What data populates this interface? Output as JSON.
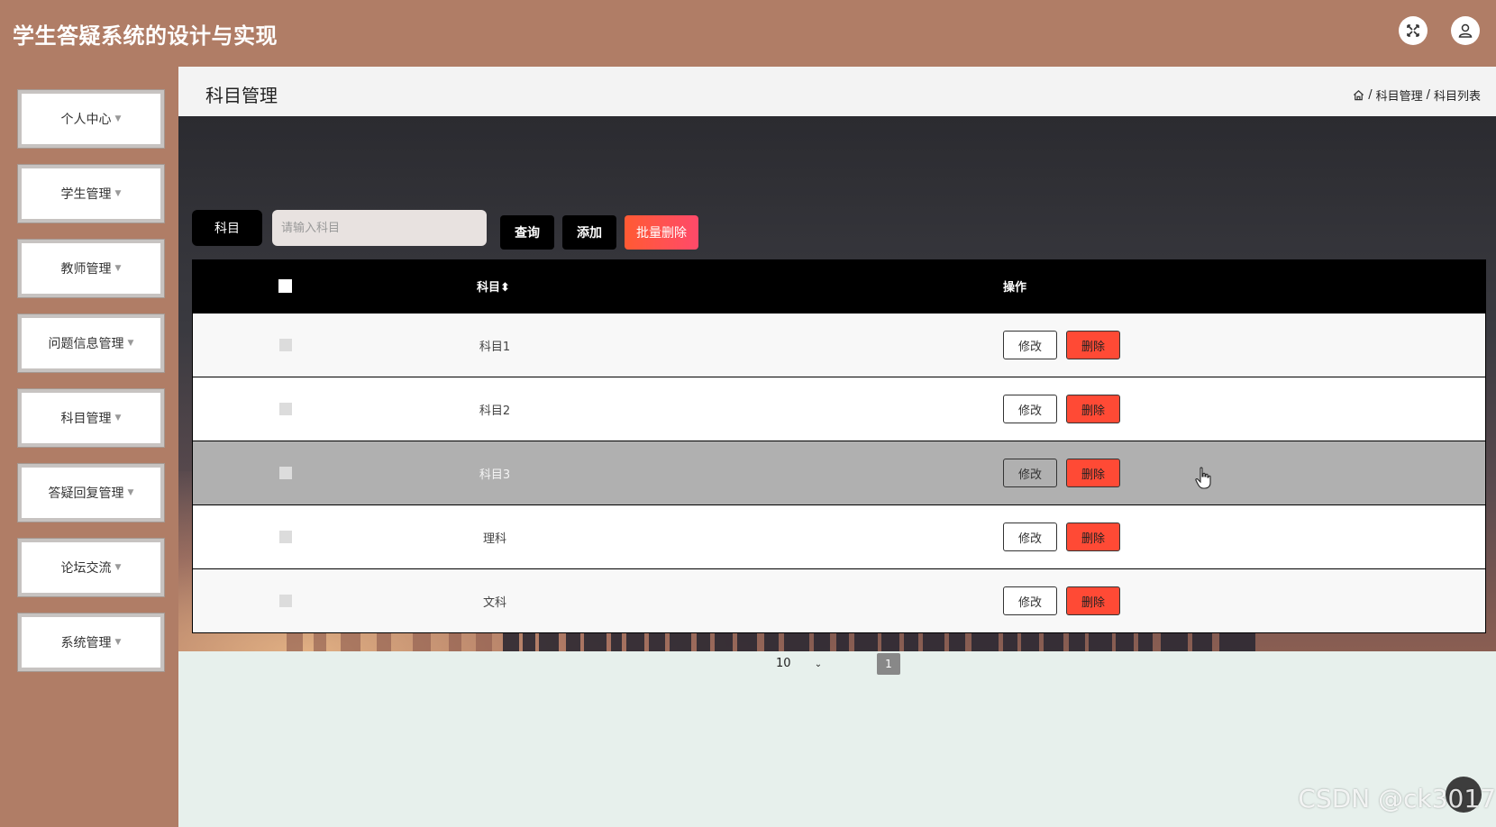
{
  "app": {
    "title": "学生答疑系统的设计与实现"
  },
  "header": {
    "fullscreen_icon": "fullscreen-icon",
    "user_icon": "user-icon"
  },
  "sidebar": {
    "items": [
      {
        "label": "个人中心"
      },
      {
        "label": "学生管理"
      },
      {
        "label": "教师管理"
      },
      {
        "label": "问题信息管理"
      },
      {
        "label": "科目管理"
      },
      {
        "label": "答疑回复管理"
      },
      {
        "label": "论坛交流"
      },
      {
        "label": "系统管理"
      }
    ]
  },
  "page": {
    "title": "科目管理",
    "breadcrumb": [
      "科目管理",
      "科目列表"
    ]
  },
  "search": {
    "label": "科目",
    "placeholder": "请输入科目",
    "query_label": "查询",
    "add_label": "添加",
    "batch_delete_label": "批量删除"
  },
  "table": {
    "headers": {
      "subject": "科目",
      "sort_icon": "⬍",
      "actions": "操作"
    },
    "rows": [
      {
        "subject": "科目1",
        "edit": "修改",
        "delete": "删除"
      },
      {
        "subject": "科目2",
        "edit": "修改",
        "delete": "删除"
      },
      {
        "subject": "科目3",
        "edit": "修改",
        "delete": "删除"
      },
      {
        "subject": "理科",
        "edit": "修改",
        "delete": "删除"
      },
      {
        "subject": "文科",
        "edit": "修改",
        "delete": "删除"
      }
    ]
  },
  "pagination": {
    "page_size": "10",
    "current_page": "1"
  },
  "watermark": "CSDN @ck3017",
  "colors": {
    "header_bg": "#b07d66",
    "danger": "#ff4a35",
    "hover_row": "#b0b0b0"
  }
}
